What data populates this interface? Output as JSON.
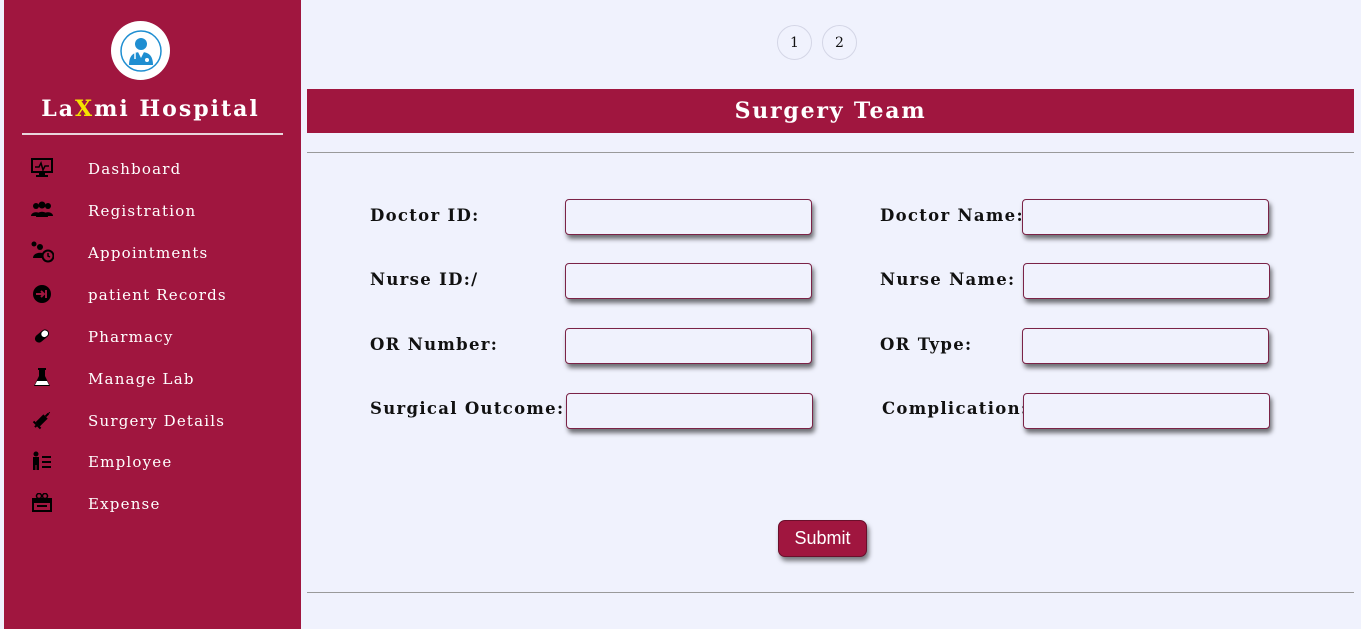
{
  "sidebar": {
    "brand_prefix": "La",
    "brand_highlight": "X",
    "brand_suffix": "mi Hospital",
    "logo_icon": "doctor-icon",
    "items": [
      {
        "label": "Dashboard",
        "icon": "monitor-icon"
      },
      {
        "label": "Registration",
        "icon": "users-icon"
      },
      {
        "label": "Appointments",
        "icon": "user-clock-icon"
      },
      {
        "label": "patient Records",
        "icon": "sign-in-icon"
      },
      {
        "label": "Pharmacy",
        "icon": "pill-icon"
      },
      {
        "label": "Manage Lab",
        "icon": "flask-icon"
      },
      {
        "label": "Surgery Details",
        "icon": "syringe-icon"
      },
      {
        "label": "Employee",
        "icon": "staff-list-icon"
      },
      {
        "label": "Expense",
        "icon": "expense-icon"
      }
    ]
  },
  "pagination": [
    "1",
    "2"
  ],
  "banner": {
    "title": "Surgery Team"
  },
  "form": {
    "doctor_id_label": "Doctor ID:",
    "doctor_name_label": "Doctor Name:",
    "nurse_id_label": "Nurse ID:/",
    "nurse_name_label": "Nurse Name:",
    "or_number_label": "OR Number:",
    "or_type_label": "OR Type:",
    "surgical_outcome_label": "Surgical Outcome:",
    "complication_label": "Complication:",
    "submit_label": "Submit"
  },
  "colors": {
    "accent": "#a0163f",
    "background": "#f0f2fd",
    "brand_highlight": "#f5e400"
  }
}
